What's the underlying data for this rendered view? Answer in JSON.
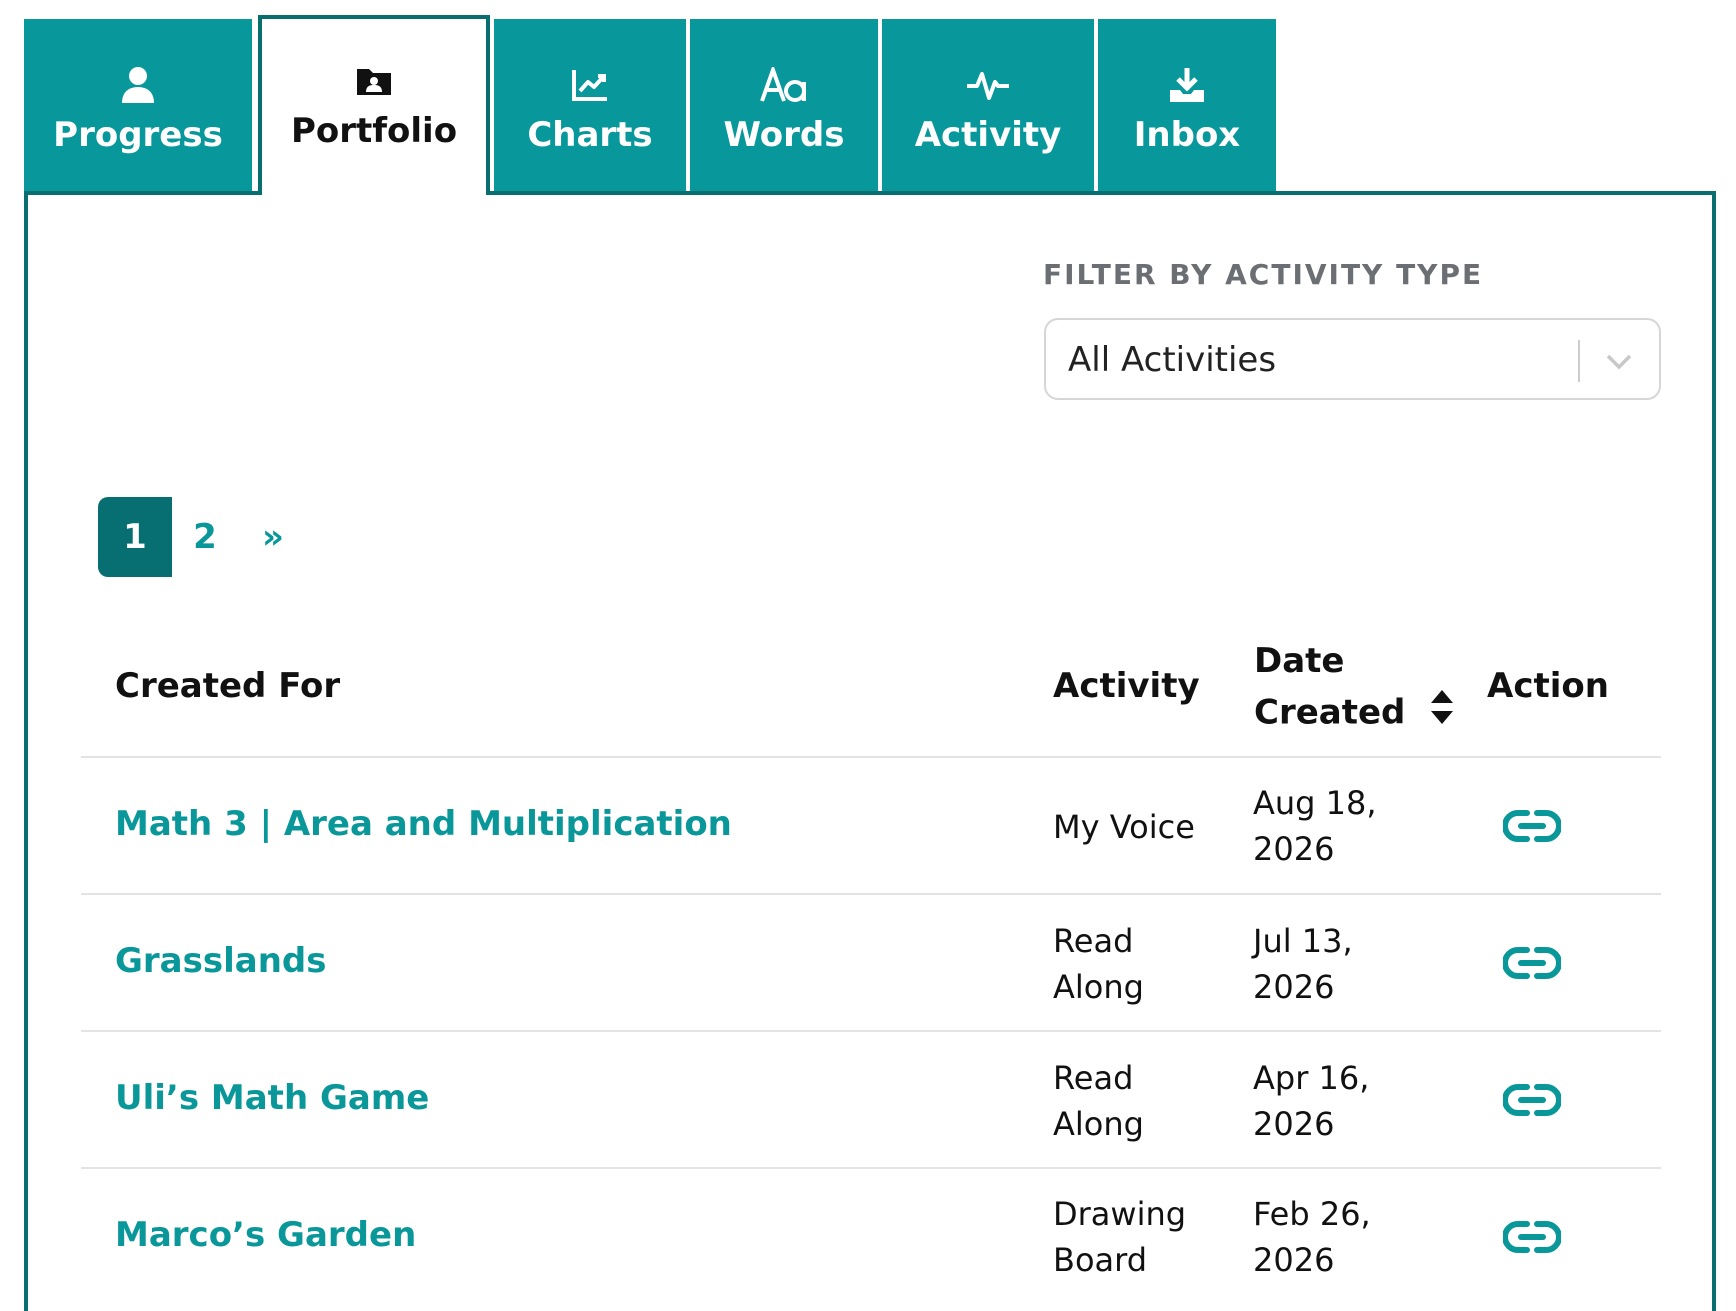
{
  "tabs": [
    {
      "label": "Progress",
      "icon": "person-icon"
    },
    {
      "label": "Portfolio",
      "icon": "folder-user-icon"
    },
    {
      "label": "Charts",
      "icon": "chart-line-icon"
    },
    {
      "label": "Words",
      "icon": "text-aa-icon"
    },
    {
      "label": "Activity",
      "icon": "heartbeat-icon"
    },
    {
      "label": "Inbox",
      "icon": "download-tray-icon"
    }
  ],
  "active_tab": "Portfolio",
  "filter": {
    "label": "FILTER BY ACTIVITY TYPE",
    "selected": "All Activities"
  },
  "pagination": {
    "pages": [
      "1",
      "2"
    ],
    "current": "1",
    "next": "»"
  },
  "table": {
    "headers": {
      "created_for": "Created For",
      "activity": "Activity",
      "date_created_line1": "Date",
      "date_created_line2": "Created",
      "action": "Action"
    },
    "rows": [
      {
        "created_for": "Math 3 | Area and Multiplication",
        "activity": "My Voice",
        "date_line1": "Aug 18,",
        "date_line2": "2026"
      },
      {
        "created_for": "Grasslands",
        "activity_line1": "Read",
        "activity_line2": "Along",
        "date_line1": "Jul 13,",
        "date_line2": "2026"
      },
      {
        "created_for": "Uli’s Math Game",
        "activity_line1": "Read",
        "activity_line2": "Along",
        "date_line1": "Apr 16,",
        "date_line2": "2026"
      },
      {
        "created_for": "Marco’s Garden",
        "activity_line1": "Drawing",
        "activity_line2": "Board",
        "date_line1": "Feb 26,",
        "date_line2": "2026"
      }
    ]
  },
  "colors": {
    "teal": "#08979a",
    "dark_teal": "#086e70",
    "link": "#09979a"
  }
}
